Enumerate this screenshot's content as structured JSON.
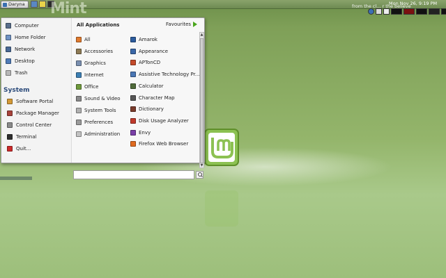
{
  "panel": {
    "user_label": "Daryna",
    "status_text": "from the cl... r the believe",
    "clock": "Mon Nov 26,  9:19 PM"
  },
  "wallpaper": {
    "watermark": "Mint"
  },
  "menu": {
    "places": [
      {
        "label": "Computer",
        "icon": "computer-icon",
        "color": "#5a6f8c"
      },
      {
        "label": "Home Folder",
        "icon": "home-folder-icon",
        "color": "#6f93c4"
      },
      {
        "label": "Network",
        "icon": "network-icon",
        "color": "#4a6a96"
      },
      {
        "label": "Desktop",
        "icon": "desktop-icon",
        "color": "#4f7bb8"
      },
      {
        "label": "Trash",
        "icon": "trash-icon",
        "color": "#b8b8b8"
      }
    ],
    "system_title": "System",
    "system_items": [
      {
        "label": "Software Portal",
        "icon": "software-portal-icon",
        "color": "#d49a36"
      },
      {
        "label": "Package Manager",
        "icon": "package-manager-icon",
        "color": "#a8433b"
      },
      {
        "label": "Control Center",
        "icon": "control-center-icon",
        "color": "#8a8a8a"
      },
      {
        "label": "Terminal",
        "icon": "terminal-icon",
        "color": "#2e2e2e"
      },
      {
        "label": "Quit...",
        "icon": "quit-icon",
        "color": "#cc2a2a"
      }
    ],
    "all_apps_label": "All Applications",
    "favourites_label": "Favourites",
    "categories": [
      {
        "label": "All",
        "icon": "all-icon",
        "color": "#e07a2e"
      },
      {
        "label": "Accessories",
        "icon": "accessories-icon",
        "color": "#8d7a54"
      },
      {
        "label": "Graphics",
        "icon": "graphics-icon",
        "color": "#7a8fb0"
      },
      {
        "label": "Internet",
        "icon": "internet-icon",
        "color": "#3c7fb4"
      },
      {
        "label": "Office",
        "icon": "office-icon",
        "color": "#6f9a3c"
      },
      {
        "label": "Sound & Video",
        "icon": "sound-video-icon",
        "color": "#8a8a8a"
      },
      {
        "label": "System Tools",
        "icon": "system-tools-icon",
        "color": "#b0b0b0"
      },
      {
        "label": "Preferences",
        "icon": "preferences-icon",
        "color": "#9a9a9a"
      },
      {
        "label": "Administration",
        "icon": "administration-icon",
        "color": "#c2c2c2"
      }
    ],
    "apps": [
      {
        "label": "Amarok",
        "icon": "amarok-icon",
        "color": "#2c5c9e"
      },
      {
        "label": "Appearance",
        "icon": "appearance-icon",
        "color": "#3a67a8"
      },
      {
        "label": "APTonCD",
        "icon": "aptoncd-icon",
        "color": "#c44a2a"
      },
      {
        "label": "Assistive Technology Pr...",
        "icon": "assistive-technology-icon",
        "color": "#4a77b5"
      },
      {
        "label": "Calculator",
        "icon": "calculator-icon",
        "color": "#4f6a3a"
      },
      {
        "label": "Character Map",
        "icon": "character-map-icon",
        "color": "#555555"
      },
      {
        "label": "Dictionary",
        "icon": "dictionary-icon",
        "color": "#7a3b2b"
      },
      {
        "label": "Disk Usage Analyzer",
        "icon": "disk-usage-analyzer-icon",
        "color": "#c0392b"
      },
      {
        "label": "Envy",
        "icon": "envy-icon",
        "color": "#7a3fa8"
      },
      {
        "label": "Firefox Web Browser",
        "icon": "firefox-icon",
        "color": "#e06a1f"
      }
    ],
    "search": {
      "value": "",
      "placeholder": ""
    }
  },
  "colors": {
    "mint_green": "#8cc152",
    "system_title": "#2b4a7a",
    "favourites_arrow": "#49a61c"
  }
}
